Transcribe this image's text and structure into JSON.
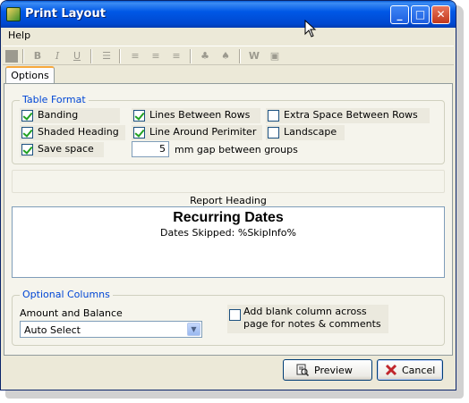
{
  "window": {
    "title": "Print Layout"
  },
  "menu": {
    "help": "Help"
  },
  "tabs": {
    "options": "Options"
  },
  "table_format": {
    "title": "Table Format",
    "banding": {
      "label": "Banding",
      "checked": true
    },
    "lines_between_rows": {
      "label": "Lines Between Rows",
      "checked": true
    },
    "extra_space": {
      "label": "Extra Space Between Rows",
      "checked": false
    },
    "shaded_heading": {
      "label": "Shaded Heading",
      "checked": true
    },
    "line_around_perimeter": {
      "label": "Line Around Perimiter",
      "checked": true
    },
    "landscape": {
      "label": "Landscape",
      "checked": false
    },
    "save_space": {
      "label": "Save space",
      "checked": true
    },
    "gap_value": "5",
    "gap_label": "mm gap between groups"
  },
  "report_heading": {
    "label": "Report Heading",
    "title": "Recurring Dates",
    "subtitle": "Dates Skipped: %SkipInfo%"
  },
  "optional_columns": {
    "title": "Optional Columns",
    "amount_label": "Amount and Balance",
    "amount_value": "Auto Select",
    "blank_column": {
      "label_line1": "Add blank column across",
      "label_line2": "page for notes & comments",
      "checked": false
    }
  },
  "buttons": {
    "preview": "Preview",
    "cancel": "Cancel"
  },
  "toolbar_icons": [
    "picture-icon",
    "bold-icon",
    "italic-icon",
    "underline-icon",
    "bullet-list-icon",
    "align-left-icon",
    "align-center-icon",
    "align-right-icon",
    "tree-icon",
    "format-icon",
    "page-setup-icon",
    "spell-icon"
  ],
  "colors": {
    "titlebar": "#0058e6",
    "group_title": "#0046d5",
    "tab_accent": "#f7a83c",
    "cancel_icon": "#c0262c"
  }
}
